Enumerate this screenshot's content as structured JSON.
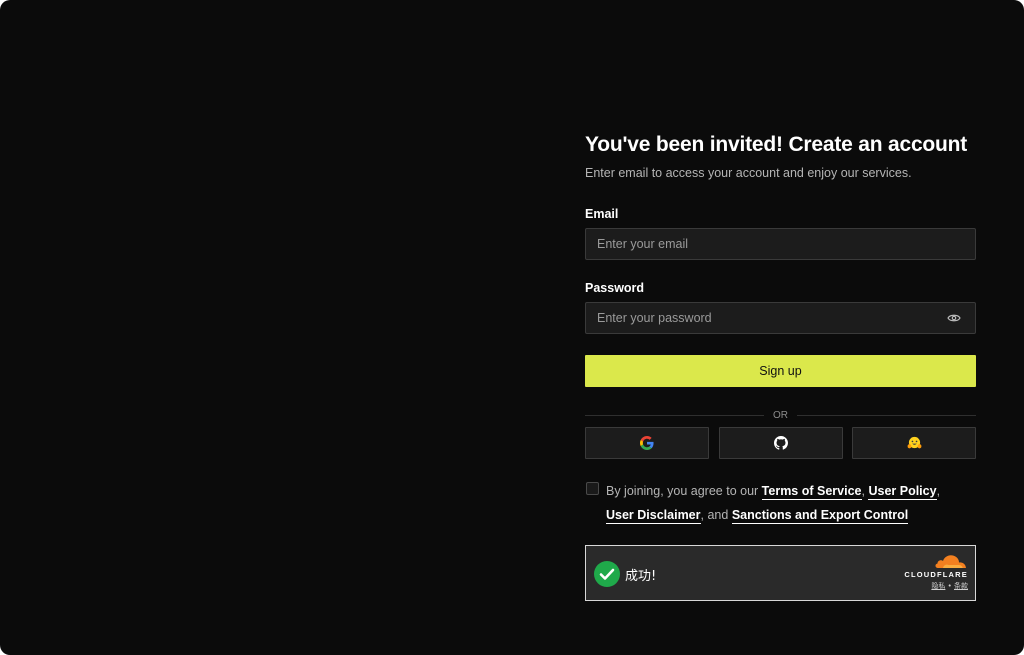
{
  "signup": {
    "title": "You've been invited! Create an account",
    "subtitle": "Enter email to access your account and enjoy our services.",
    "email_label": "Email",
    "email_placeholder": "Enter your email",
    "password_label": "Password",
    "password_placeholder": "Enter your password",
    "submit_label": "Sign up",
    "divider_text": "OR",
    "social_providers": [
      "google-icon",
      "github-icon",
      "huggingface-icon"
    ]
  },
  "terms": {
    "prefix": "By joining, you agree to our",
    "terms_of_service": "Terms of Service",
    "comma1": ",",
    "user_policy": "User Policy",
    "comma2": ",",
    "user_disclaimer": "User Disclaimer",
    "and_text": ", and",
    "sanctions": "Sanctions and Export Control"
  },
  "captcha": {
    "status": "成功!",
    "brand": "CLOUDFLARE",
    "privacy": "隐私",
    "separator": "•",
    "terms": "条款"
  },
  "colors": {
    "background": "#0b0b0b",
    "accent": "#dbe84b",
    "input_bg": "#1c1c1c",
    "success": "#1fa94a",
    "cloudflare": "#f38020"
  }
}
